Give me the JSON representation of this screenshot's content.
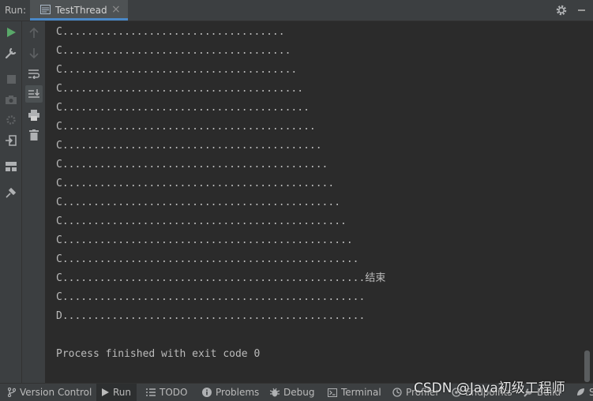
{
  "header": {
    "run_label": "Run:",
    "tab_title": "TestThread",
    "tab_close": "×"
  },
  "console": {
    "lines": [
      "C....................................",
      "C.....................................",
      "C......................................",
      "C.......................................",
      "C........................................",
      "C.........................................",
      "C..........................................",
      "C...........................................",
      "C............................................",
      "C.............................................",
      "C..............................................",
      "C...............................................",
      "C................................................",
      "C.................................................结束",
      "C.................................................",
      "D.................................................",
      "",
      "Process finished with exit code 0"
    ]
  },
  "bottom_tabs": [
    {
      "label": "Version Control",
      "icon": "branch-icon"
    },
    {
      "label": "Run",
      "icon": "run-icon"
    },
    {
      "label": "TODO",
      "icon": "list-icon"
    },
    {
      "label": "Problems",
      "icon": "info-icon"
    },
    {
      "label": "Debug",
      "icon": "bug-icon"
    },
    {
      "label": "Terminal",
      "icon": "terminal-icon"
    },
    {
      "label": "Profiler",
      "icon": "profiler-icon"
    },
    {
      "label": "Endpoints",
      "icon": "endpoints-icon"
    },
    {
      "label": "Build",
      "icon": "build-icon"
    },
    {
      "label": "S",
      "icon": "spring-icon"
    }
  ],
  "watermark": "CSDN @Java初级工程师",
  "colors": {
    "accent": "#4a88c7",
    "run_green": "#59a869",
    "background": "#2b2b2b",
    "panel": "#3c3f41"
  }
}
